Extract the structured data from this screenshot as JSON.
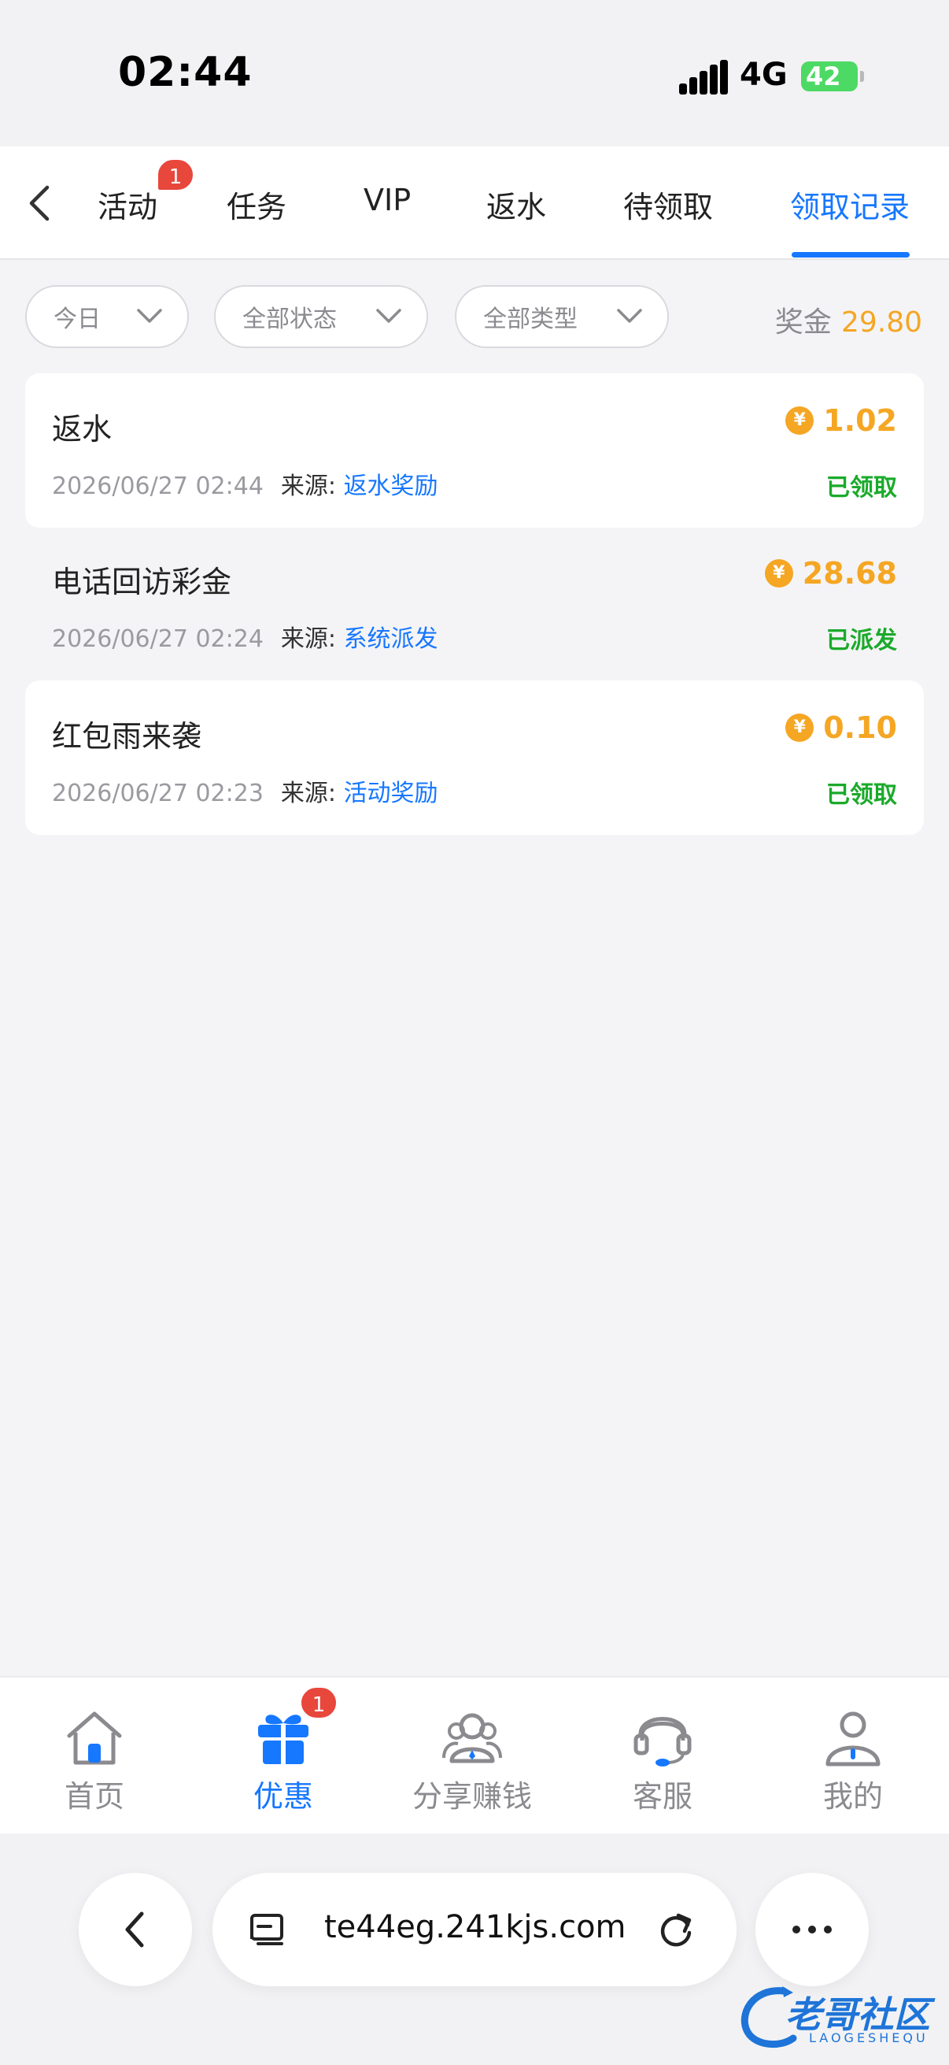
{
  "status_bar": {
    "time": "02:44",
    "network": "4G",
    "battery": "42"
  },
  "tabs": [
    {
      "label": "活动",
      "badge": "1"
    },
    {
      "label": "任务"
    },
    {
      "label": "VIP"
    },
    {
      "label": "返水"
    },
    {
      "label": "待领取"
    },
    {
      "label": "领取记录",
      "active": true
    }
  ],
  "filters": {
    "date": "今日",
    "status": "全部状态",
    "type": "全部类型"
  },
  "bonus": {
    "label": "奖金",
    "amount": "29.80"
  },
  "records": [
    {
      "title": "返水",
      "time": "2026/06/27 02:44",
      "source_label": "来源:",
      "source": "返水奖励",
      "amount": "1.02",
      "status": "已领取"
    },
    {
      "title": "电话回访彩金",
      "time": "2026/06/27 02:24",
      "source_label": "来源:",
      "source": "系统派发",
      "amount": "28.68",
      "status": "已派发"
    },
    {
      "title": "红包雨来袭",
      "time": "2026/06/27 02:23",
      "source_label": "来源:",
      "source": "活动奖励",
      "amount": "0.10",
      "status": "已领取"
    }
  ],
  "coin_symbol": "¥",
  "bottom_nav": [
    {
      "label": "首页",
      "icon": "home-icon"
    },
    {
      "label": "优惠",
      "icon": "gift-icon",
      "active": true,
      "badge": "1"
    },
    {
      "label": "分享赚钱",
      "icon": "share-earn-icon"
    },
    {
      "label": "客服",
      "icon": "headset-icon"
    },
    {
      "label": "我的",
      "icon": "profile-icon"
    }
  ],
  "browser": {
    "url": "te44eg.241kjs.com"
  },
  "watermark": {
    "text": "老哥社区",
    "sub": "LAOGESHEQU"
  },
  "colors": {
    "accent": "#1677ff",
    "gold": "#f5a623",
    "success": "#1aaa2a",
    "badge": "#e8473c"
  }
}
